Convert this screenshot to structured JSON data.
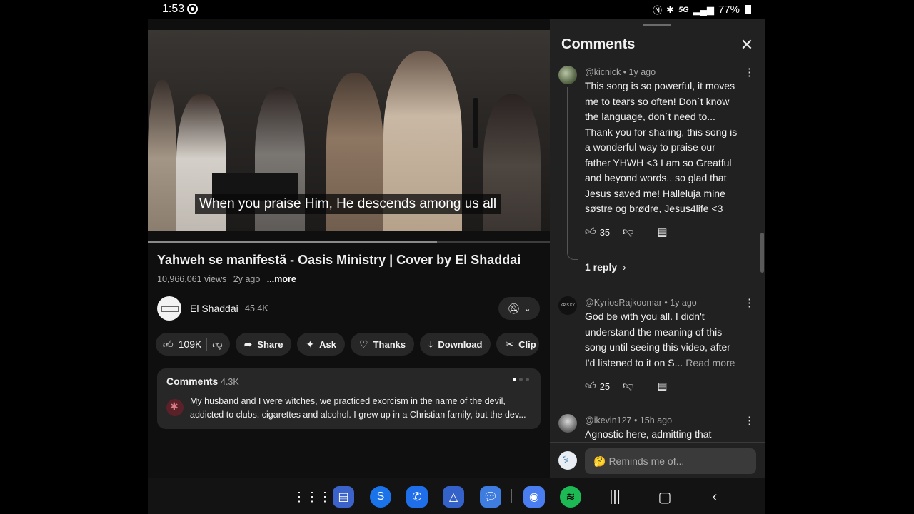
{
  "status_bar": {
    "time": "1:53",
    "network": "5G",
    "battery": "77%",
    "icons": [
      "nfc-icon",
      "bluetooth-icon",
      "signal-icon",
      "battery-icon"
    ]
  },
  "video": {
    "subtitle": "When you praise Him, He descends among us all",
    "progress": 0.72,
    "title": "Yahweh se manifestă - Oasis Ministry | Cover by El Shaddai",
    "views": "10,966,061 views",
    "age": "2y ago",
    "more": "...more"
  },
  "channel": {
    "name": "El Shaddai",
    "subscribers": "45.4K"
  },
  "actions": {
    "likes": "109K",
    "share": "Share",
    "ask": "Ask",
    "thanks": "Thanks",
    "download": "Download",
    "clip": "Clip"
  },
  "comments_card": {
    "title": "Comments",
    "count": "4.3K",
    "line1": "My husband and I were witches, we practiced exorcism in the name of the devil,",
    "line2": "addicted to clubs, cigarettes and alcohol. I grew up in a Christian family, but the dev..."
  },
  "panel": {
    "title": "Comments",
    "comments": [
      {
        "author": "@kicnick",
        "age": "1y ago",
        "lines": [
          "This song is so powerful, it moves",
          "me to tears so often! Don`t know",
          "the language, don`t need to...",
          "Thank you for sharing, this song is",
          "a wonderful way to praise our",
          "father YHWH <3 I am so Greatful",
          "and beyond words.. so glad that",
          "Jesus saved me! Halleluja mine",
          "søstre og brødre, Jesus4life <3"
        ],
        "likes": "35",
        "replies": "1 reply"
      },
      {
        "author": "@KyriosRajkoomar",
        "age": "1y ago",
        "avatar_text": "KRIS KY",
        "lines": [
          "God be with you all. I didn't",
          "understand the meaning of this",
          "song until seeing this video, after"
        ],
        "last_line": "I'd listened to it on S...",
        "read_more": "Read more",
        "likes": "25"
      },
      {
        "author": "@ikevin127",
        "age": "15h ago",
        "lines": [
          "Agnostic here, admitting that"
        ]
      }
    ],
    "reply_placeholder": "Reminds me of...",
    "reply_emoji": "🤔"
  },
  "nav": {
    "apps": [
      "app-drawer-icon",
      "docs-icon",
      "shazam-icon",
      "phone-icon",
      "drive-icon",
      "messages-icon",
      "camera-icon",
      "spotify-icon"
    ],
    "colors": {
      "docs": "#3b63c9",
      "shazam": "#1a73e8",
      "phone": "#1f6feb",
      "drive": "#3562c9",
      "messages": "#3e7ce0",
      "camera": "#4a7ef0",
      "spotify": "#1db954"
    }
  }
}
